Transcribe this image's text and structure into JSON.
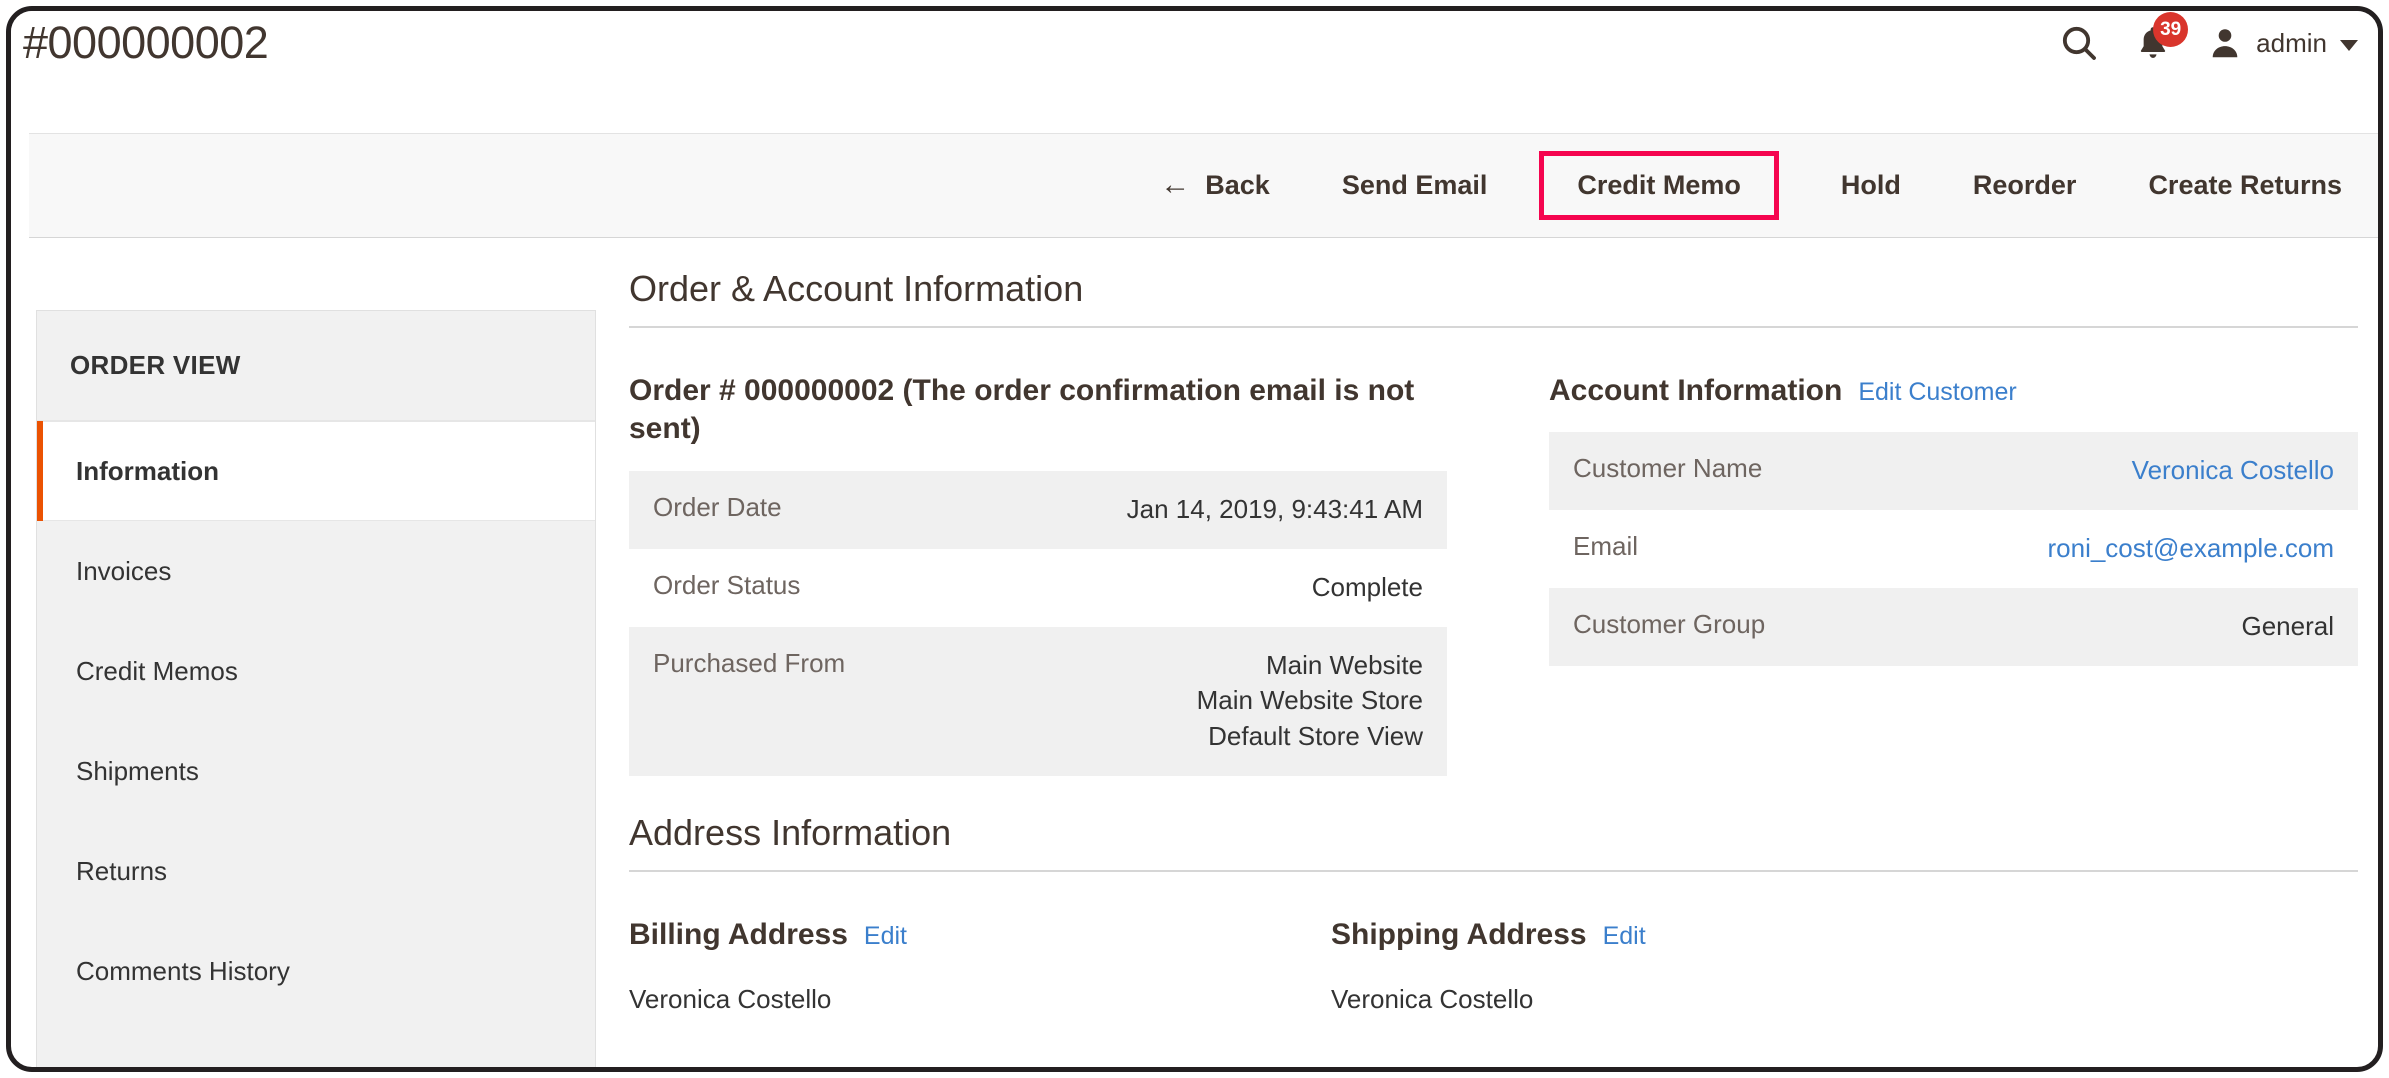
{
  "header": {
    "page_title": "#000000002",
    "search_icon": "search-icon",
    "notification_icon": "bell-icon",
    "notification_count": "39",
    "user_icon": "user-avatar-icon",
    "admin_label": "admin",
    "caret_icon": "chevron-down-icon"
  },
  "toolbar": {
    "back_icon": "←",
    "back_label": "Back",
    "send_email_label": "Send Email",
    "credit_memo_label": "Credit Memo",
    "hold_label": "Hold",
    "reorder_label": "Reorder",
    "create_returns_label": "Create Returns",
    "highlight_color": "#f5054f"
  },
  "sidebar": {
    "title": "ORDER VIEW",
    "active_accent_color": "#eb5202",
    "items": [
      {
        "label": "Information",
        "active": true
      },
      {
        "label": "Invoices",
        "active": false
      },
      {
        "label": "Credit Memos",
        "active": false
      },
      {
        "label": "Shipments",
        "active": false
      },
      {
        "label": "Returns",
        "active": false
      },
      {
        "label": "Comments History",
        "active": false
      }
    ]
  },
  "order_account_section": {
    "heading": "Order & Account Information",
    "order_block": {
      "title": "Order # 000000002 (The order confirmation email is not sent)",
      "rows": [
        {
          "label": "Order Date",
          "value": "Jan 14, 2019, 9:43:41 AM"
        },
        {
          "label": "Order Status",
          "value": "Complete"
        },
        {
          "label": "Purchased From",
          "value": "Main Website\nMain Website Store\nDefault Store View"
        }
      ]
    },
    "account_block": {
      "title": "Account Information",
      "edit_link": "Edit Customer",
      "rows": [
        {
          "label": "Customer Name",
          "value": "Veronica Costello",
          "is_link": true
        },
        {
          "label": "Email",
          "value": "roni_cost@example.com",
          "is_link": true
        },
        {
          "label": "Customer Group",
          "value": "General",
          "is_link": false
        }
      ]
    }
  },
  "address_section": {
    "heading": "Address Information",
    "billing": {
      "title": "Billing Address",
      "edit_link": "Edit",
      "line1": "Veronica Costello"
    },
    "shipping": {
      "title": "Shipping Address",
      "edit_link": "Edit",
      "line1": "Veronica Costello"
    }
  }
}
